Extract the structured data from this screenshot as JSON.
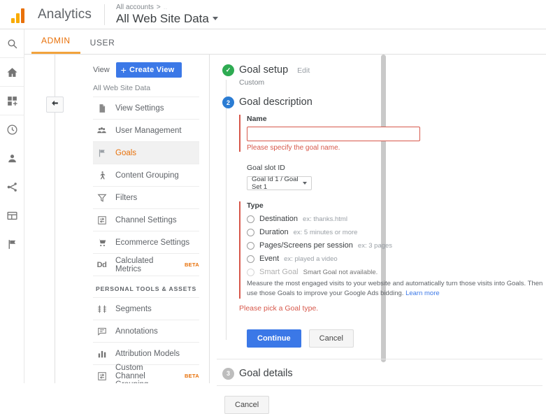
{
  "header": {
    "brand": "Analytics",
    "breadcrumb_root": "All accounts",
    "breadcrumb_sep": ">",
    "breadcrumb_truncated": "..",
    "account_title": "All Web Site Data"
  },
  "rail": {
    "items": [
      {
        "label": "Search",
        "icon": "search-icon"
      },
      {
        "label": "Home",
        "icon": "home-icon"
      },
      {
        "label": "Customization",
        "icon": "customization-icon"
      },
      {
        "label": "Realtime",
        "icon": "clock-icon"
      },
      {
        "label": "Audience",
        "icon": "person-icon"
      },
      {
        "label": "Acquisition",
        "icon": "share-icon"
      },
      {
        "label": "Behavior",
        "icon": "window-icon"
      },
      {
        "label": "Conversions",
        "icon": "flag-icon"
      }
    ]
  },
  "tabs": [
    {
      "label": "ADMIN",
      "active": true
    },
    {
      "label": "USER",
      "active": false
    }
  ],
  "admin_nav": {
    "view_label": "View",
    "create_view_label": "Create View",
    "view_name": "All Web Site Data",
    "items": [
      {
        "label": "View Settings",
        "icon": "document-icon",
        "active": false,
        "badge": ""
      },
      {
        "label": "User Management",
        "icon": "users-icon",
        "active": false,
        "badge": ""
      },
      {
        "label": "Goals",
        "icon": "flag-icon",
        "active": true,
        "badge": ""
      },
      {
        "label": "Content Grouping",
        "icon": "person-walking-icon",
        "active": false,
        "badge": ""
      },
      {
        "label": "Filters",
        "icon": "funnel-icon",
        "active": false,
        "badge": ""
      },
      {
        "label": "Channel Settings",
        "icon": "channel-icon",
        "active": false,
        "badge": ""
      },
      {
        "label": "Ecommerce Settings",
        "icon": "cart-icon",
        "active": false,
        "badge": ""
      },
      {
        "label": "Calculated Metrics",
        "icon": "dd-icon",
        "active": false,
        "badge": "BETA"
      }
    ],
    "section_header": "PERSONAL TOOLS & ASSETS",
    "personal_items": [
      {
        "label": "Segments",
        "icon": "segments-icon",
        "active": false,
        "badge": ""
      },
      {
        "label": "Annotations",
        "icon": "annotation-icon",
        "active": false,
        "badge": ""
      },
      {
        "label": "Attribution Models",
        "icon": "bars-icon",
        "active": false,
        "badge": ""
      },
      {
        "label": "Custom Channel Grouping",
        "icon": "channel-icon",
        "active": false,
        "badge": "BETA"
      }
    ]
  },
  "wizard": {
    "step1": {
      "number": "✓",
      "title": "Goal setup",
      "edit_label": "Edit",
      "subtitle": "Custom"
    },
    "step2": {
      "number": "2",
      "title": "Goal description",
      "name_label": "Name",
      "name_value": "",
      "name_error": "Please specify the goal name.",
      "slot_label": "Goal slot ID",
      "slot_value": "Goal Id 1 / Goal Set 1",
      "type_label": "Type",
      "types": [
        {
          "label": "Destination",
          "example": "ex: thanks.html",
          "disabled": false
        },
        {
          "label": "Duration",
          "example": "ex: 5 minutes or more",
          "disabled": false
        },
        {
          "label": "Pages/Screens per session",
          "example": "ex: 3 pages",
          "disabled": false
        },
        {
          "label": "Event",
          "example": "ex: played a video",
          "disabled": false
        },
        {
          "label": "Smart Goal",
          "example": "Smart Goal not available.",
          "disabled": true
        }
      ],
      "smart_goal_desc": "Measure the most engaged visits to your website and automatically turn those visits into Goals. Then use those Goals to improve your Google Ads bidding.",
      "smart_goal_link": "Learn more",
      "type_error": "Please pick a Goal type.",
      "continue_label": "Continue",
      "cancel_label": "Cancel"
    },
    "step3": {
      "number": "3",
      "title": "Goal details"
    },
    "bottom_cancel_label": "Cancel"
  },
  "colors": {
    "accent_orange": "#e8710a",
    "primary_blue": "#3b78e7",
    "error_red": "#d7584b",
    "success_green": "#2eab52",
    "step_blue": "#2b7cd3"
  }
}
